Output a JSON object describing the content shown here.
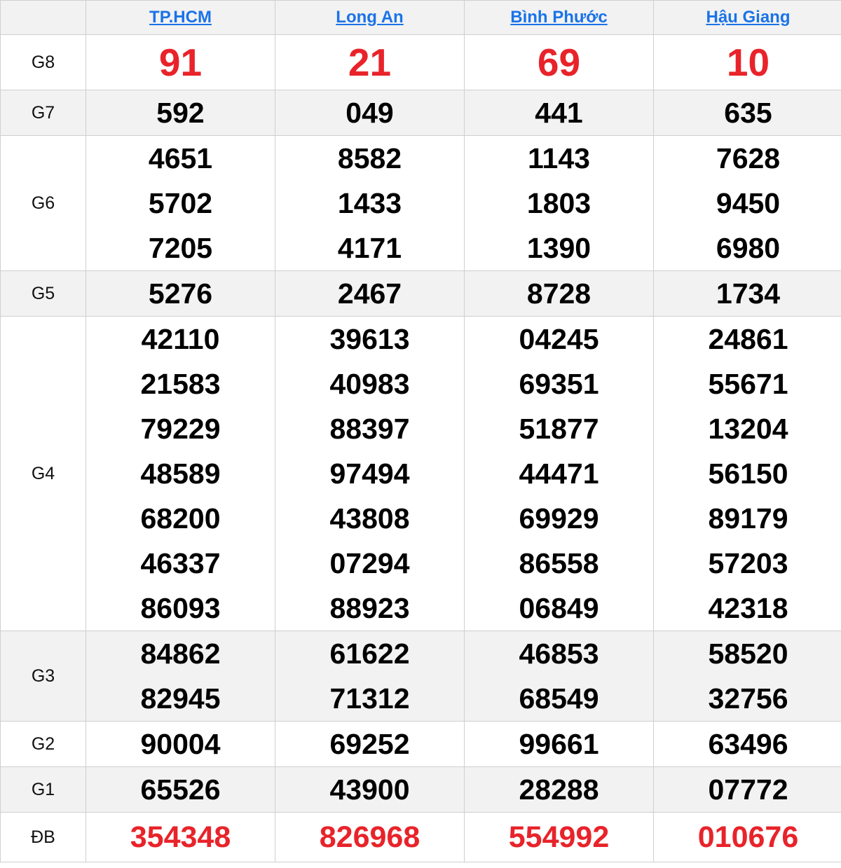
{
  "provinces": [
    "TP.HCM",
    "Long An",
    "Bình Phước",
    "Hậu Giang"
  ],
  "prizes": [
    {
      "label": "G8",
      "values": [
        [
          "91"
        ],
        [
          "21"
        ],
        [
          "69"
        ],
        [
          "10"
        ]
      ]
    },
    {
      "label": "G7",
      "values": [
        [
          "592"
        ],
        [
          "049"
        ],
        [
          "441"
        ],
        [
          "635"
        ]
      ]
    },
    {
      "label": "G6",
      "values": [
        [
          "4651",
          "5702",
          "7205"
        ],
        [
          "8582",
          "1433",
          "4171"
        ],
        [
          "1143",
          "1803",
          "1390"
        ],
        [
          "7628",
          "9450",
          "6980"
        ]
      ]
    },
    {
      "label": "G5",
      "values": [
        [
          "5276"
        ],
        [
          "2467"
        ],
        [
          "8728"
        ],
        [
          "1734"
        ]
      ]
    },
    {
      "label": "G4",
      "values": [
        [
          "42110",
          "21583",
          "79229",
          "48589",
          "68200",
          "46337",
          "86093"
        ],
        [
          "39613",
          "40983",
          "88397",
          "97494",
          "43808",
          "07294",
          "88923"
        ],
        [
          "04245",
          "69351",
          "51877",
          "44471",
          "69929",
          "86558",
          "06849"
        ],
        [
          "24861",
          "55671",
          "13204",
          "56150",
          "89179",
          "57203",
          "42318"
        ]
      ]
    },
    {
      "label": "G3",
      "values": [
        [
          "84862",
          "82945"
        ],
        [
          "61622",
          "71312"
        ],
        [
          "46853",
          "68549"
        ],
        [
          "58520",
          "32756"
        ]
      ]
    },
    {
      "label": "G2",
      "values": [
        [
          "90004"
        ],
        [
          "69252"
        ],
        [
          "99661"
        ],
        [
          "63496"
        ]
      ]
    },
    {
      "label": "G1",
      "values": [
        [
          "65526"
        ],
        [
          "43900"
        ],
        [
          "28288"
        ],
        [
          "07772"
        ]
      ]
    },
    {
      "label": "ĐB",
      "values": [
        [
          "354348"
        ],
        [
          "826968"
        ],
        [
          "554992"
        ],
        [
          "010676"
        ]
      ]
    }
  ],
  "colors": {
    "highlight": "#e8232a",
    "link": "#1a73e8",
    "alt_row": "#f2f2f2"
  }
}
